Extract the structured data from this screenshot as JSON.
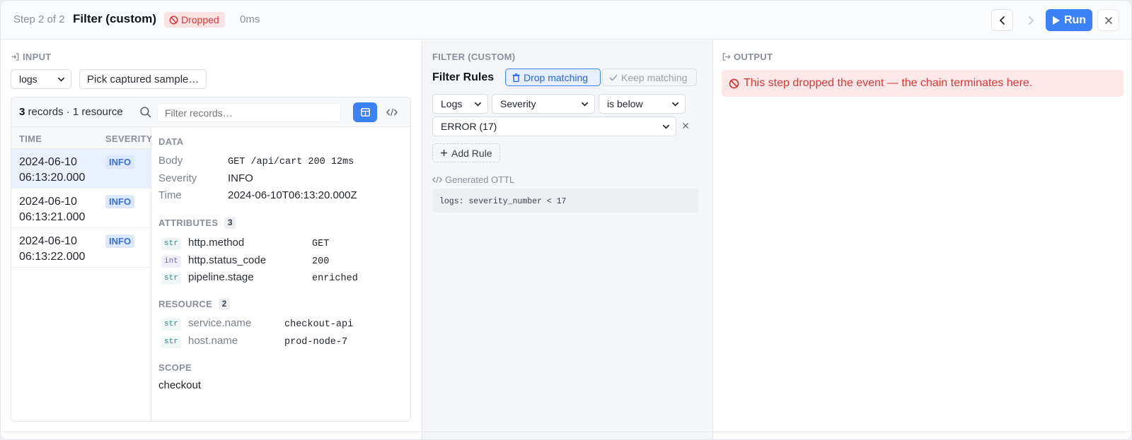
{
  "header": {
    "step": "Step 2 of 2",
    "title": "Filter (custom)",
    "status_badge": "Dropped",
    "duration": "0ms",
    "run_label": "Run"
  },
  "input": {
    "section_label": "INPUT",
    "signal_select": "logs",
    "pick_sample": "Pick captured sample…",
    "records_count": "3",
    "records_summary": "records · 1 resource",
    "filter_placeholder": "Filter records…",
    "columns": [
      "TIME",
      "SEVERITY"
    ],
    "records": [
      {
        "time_line1": "2024-06-10",
        "time_line2": "06:13:20.000",
        "severity": "INFO"
      },
      {
        "time_line1": "2024-06-10",
        "time_line2": "06:13:21.000",
        "severity": "INFO"
      },
      {
        "time_line1": "2024-06-10",
        "time_line2": "06:13:22.000",
        "severity": "INFO"
      }
    ],
    "detail": {
      "data_label": "DATA",
      "body_key": "Body",
      "body_val": "GET /api/cart 200 12ms",
      "severity_key": "Severity",
      "severity_val": "INFO",
      "time_key": "Time",
      "time_val": "2024-06-10T06:13:20.000Z",
      "attributes_label": "ATTRIBUTES",
      "attributes_count": "3",
      "attributes": [
        {
          "type": "str",
          "key": "http.method",
          "value": "GET"
        },
        {
          "type": "int",
          "key": "http.status_code",
          "value": "200"
        },
        {
          "type": "str",
          "key": "pipeline.stage",
          "value": "enriched"
        }
      ],
      "resource_label": "RESOURCE",
      "resource_count": "2",
      "resource": [
        {
          "type": "str",
          "key": "service.name",
          "value": "checkout-api"
        },
        {
          "type": "str",
          "key": "host.name",
          "value": "prod-node-7"
        }
      ],
      "scope_label": "SCOPE",
      "scope_val": "checkout"
    }
  },
  "filter": {
    "section_label": "FILTER (CUSTOM)",
    "rules_title": "Filter Rules",
    "drop_label": "Drop matching",
    "keep_label": "Keep matching",
    "rule_signal": "Logs",
    "rule_field": "Severity",
    "rule_operator": "is below",
    "rule_value": "ERROR (17)",
    "add_rule": "Add Rule",
    "generated_label": "Generated OTTL",
    "generated_code": "logs: severity_number < 17"
  },
  "output": {
    "section_label": "OUTPUT",
    "alert": "This step dropped the event — the chain terminates here."
  }
}
